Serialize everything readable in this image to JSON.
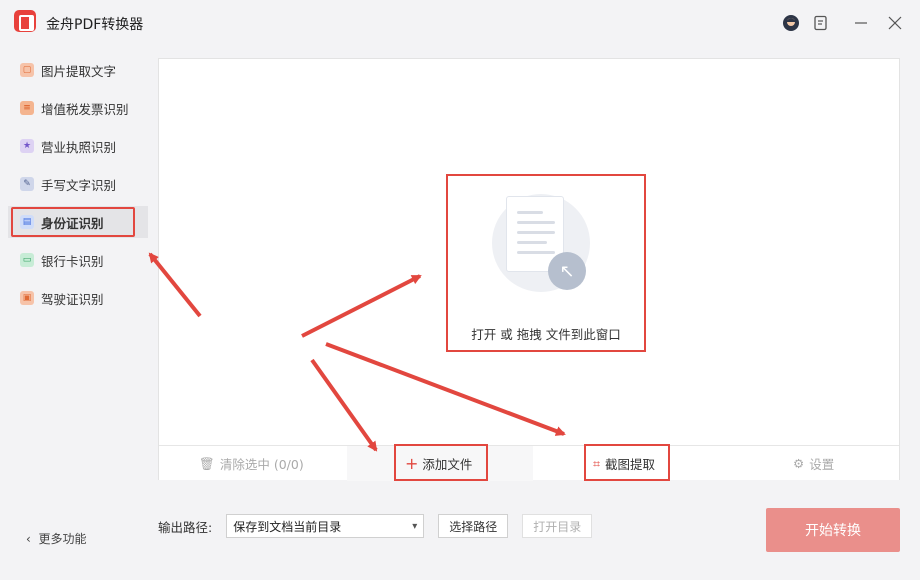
{
  "app": {
    "title": "金舟PDF转换器"
  },
  "sidebar": {
    "items": [
      {
        "label": "图片提取文字",
        "icon": "image-text-icon",
        "color": "#f08a5d",
        "active": false
      },
      {
        "label": "增值税发票识别",
        "icon": "invoice-icon",
        "color": "#ef7b45",
        "active": false
      },
      {
        "label": "营业执照识别",
        "icon": "license-star-icon",
        "color": "#8b6fd1",
        "active": false
      },
      {
        "label": "手写文字识别",
        "icon": "pen-icon",
        "color": "#6e7fb8",
        "active": false
      },
      {
        "label": "身份证识别",
        "icon": "id-card-icon",
        "color": "#4e7de9",
        "active": true
      },
      {
        "label": "银行卡识别",
        "icon": "bank-card-icon",
        "color": "#39b36b",
        "active": false
      },
      {
        "label": "驾驶证识别",
        "icon": "car-icon",
        "color": "#ef7b45",
        "active": false
      }
    ],
    "more_label": "更多功能"
  },
  "dropzone": {
    "text": "打开 或 拖拽 文件到此窗口"
  },
  "actions": {
    "clear_label": "清除选中 (0/0)",
    "add_label": "添加文件",
    "crop_label": "截图提取",
    "settings_label": "设置"
  },
  "output": {
    "label": "输出路径:",
    "selected": "保存到文档当前目录",
    "choose_label": "选择路径",
    "open_label": "打开目录"
  },
  "start_label": "开始转换",
  "colors": {
    "accent": "#e2473f",
    "start_bg": "#ea8f8b"
  }
}
